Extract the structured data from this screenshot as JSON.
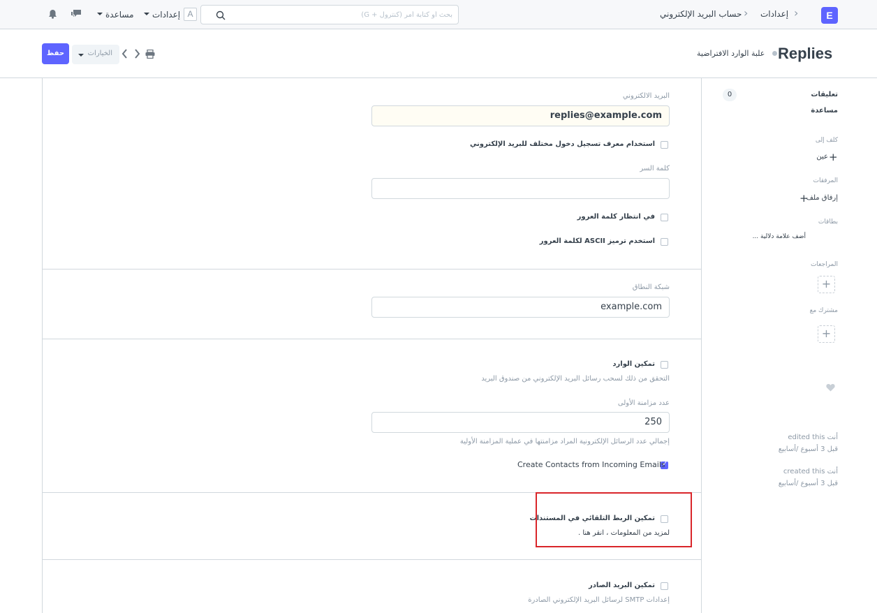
{
  "navbar": {
    "logo_letter": "E",
    "breadcrumb": [
      "إعدادات",
      "حساب البريد الإلكتروني"
    ],
    "search_placeholder": "بحث أو كتابة أمر (كنترول + G)",
    "user_initial": "A",
    "settings_label": "إعدادات",
    "help_label": "مساعدة"
  },
  "page": {
    "title": "Replies",
    "subtitle": "علبة الوارد الافتراضية",
    "save_label": "حفظ",
    "options_label": "الخيارات"
  },
  "form": {
    "email_label": "البريد الالكتروني",
    "email_value": "replies@example.com",
    "use_diff_login_label": "استخدام معرف تسجيل دخول مختلف للبريد الإلكتروني",
    "password_label": "كلمة السر",
    "password_value": "",
    "awaiting_password_label": "في انتظار كلمة العرور",
    "ascii_password_label": "استخدم ترميز ASCII لكلمة العرور",
    "domain_label": "شبكة النطاق",
    "domain_value": "example.com",
    "enable_incoming_label": "تمكين الوارد",
    "enable_incoming_desc": "التحقق من ذلك لسحب رسائل البريد الإلكتروني من صندوق البريد",
    "initial_sync_label": "عدد مزامنة الأولى",
    "initial_sync_value": "250",
    "initial_sync_desc": "إجمالي عدد الرسائل الإلكترونية المراد مزامنتها في عملية المزامنة الأولية",
    "create_contacts_label": "Create Contacts from Incoming Emails",
    "create_contacts_checked": true,
    "auto_link_label": "تمكين الربط التلقائي في المستندات",
    "auto_link_desc": "لمزيد من المعلومات ، انقر هنا .",
    "enable_outgoing_label": "تمكين البريد الصادر",
    "enable_outgoing_desc": "إعدادات SMTP لرسائل البريد الإلكتروني الصادرة"
  },
  "sidebar": {
    "comments_label": "تعليقات",
    "comments_count": "0",
    "help_label": "مساعدة",
    "assign_label": "كلف إلى",
    "assign_action": "عين",
    "attachments_label": "المرفقات",
    "attach_action": "إرفاق ملف",
    "tags_label": "بطاقات",
    "add_tag": "أضف علامة دلالية ...",
    "reviews_label": "المراجعات",
    "shared_label": "مشترك مع",
    "edited_line": "أنت edited this",
    "edited_time": "قبل 3 أسبوع /أسابيع",
    "created_line": "أنت created this",
    "created_time": "قبل 3 أسبوع /أسابيع"
  },
  "colors": {
    "primary": "#5e64ff",
    "highlight_border": "#d9252a"
  }
}
